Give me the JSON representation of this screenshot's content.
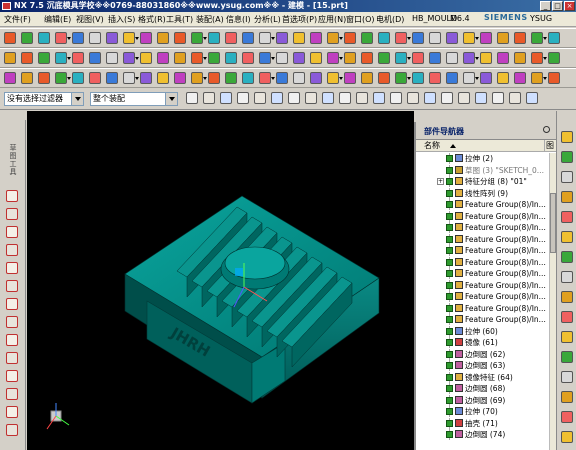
{
  "window": {
    "title": "NX 7.5 沉底模具学校※※0769-88031860※※www.ysug.com※※ - 建模 - [15.prt]",
    "controls": [
      "_",
      "□",
      "×"
    ]
  },
  "menu": {
    "items": [
      "文件(F)",
      "编辑(E)",
      "视图(V)",
      "插入(S)",
      "格式(R)",
      "工具(T)",
      "装配(A)",
      "信息(I)",
      "分析(L)",
      "首选项(P)",
      "应用(N)",
      "窗口(O)",
      "电机(D)"
    ],
    "plugins": [
      "HB_MOULD",
      "M6.4",
      "YSUG"
    ],
    "brand": "SIEMENS"
  },
  "selection_bar": {
    "filter_value": "没有选择过滤器",
    "scope_value": "整个装配"
  },
  "left_toolbar": {
    "vertical_label": "草图工具"
  },
  "navigator": {
    "title": "部件导航器",
    "col_name": "名称",
    "col_extra": "图",
    "rows": [
      {
        "label": "拉伸 (2)",
        "dim": false,
        "icon_color": "#6b8bd6"
      },
      {
        "label": "草图 (3) \"SKETCH_0...",
        "dim": true,
        "icon_color": "#c8a030"
      },
      {
        "label": "特征分组 (8) \"01\"",
        "dim": false,
        "icon_color": "#e0b040",
        "expander": "+"
      },
      {
        "label": "线性阵列 (9)",
        "dim": false,
        "icon_color": "#e0b040"
      },
      {
        "label": "Feature Group(8)/In...",
        "dim": false,
        "icon_color": "#e0b040"
      },
      {
        "label": "Feature Group(8)/In...",
        "dim": false,
        "icon_color": "#e0b040"
      },
      {
        "label": "Feature Group(8)/In...",
        "dim": false,
        "icon_color": "#e0b040"
      },
      {
        "label": "Feature Group(8)/In...",
        "dim": false,
        "icon_color": "#e0b040"
      },
      {
        "label": "Feature Group(8)/In...",
        "dim": false,
        "icon_color": "#e0b040"
      },
      {
        "label": "Feature Group(8)/In...",
        "dim": false,
        "icon_color": "#e0b040"
      },
      {
        "label": "Feature Group(8)/In...",
        "dim": false,
        "icon_color": "#e0b040"
      },
      {
        "label": "Feature Group(8)/In...",
        "dim": false,
        "icon_color": "#e0b040"
      },
      {
        "label": "Feature Group(8)/In...",
        "dim": false,
        "icon_color": "#e0b040"
      },
      {
        "label": "Feature Group(8)/In...",
        "dim": false,
        "icon_color": "#e0b040"
      },
      {
        "label": "Feature Group(8)/In...",
        "dim": false,
        "icon_color": "#e0b040"
      },
      {
        "label": "拉伸 (60)",
        "dim": false,
        "icon_color": "#6b8bd6"
      },
      {
        "label": "镜像 (61)",
        "dim": false,
        "icon_color": "#d04040"
      },
      {
        "label": "边倒圆 (62)",
        "dim": false,
        "icon_color": "#c060a0"
      },
      {
        "label": "边倒圆 (63)",
        "dim": false,
        "icon_color": "#c060a0"
      },
      {
        "label": "镜像特征 (64)",
        "dim": false,
        "icon_color": "#e0b040"
      },
      {
        "label": "边倒圆 (68)",
        "dim": false,
        "icon_color": "#c060a0"
      },
      {
        "label": "边倒圆 (69)",
        "dim": false,
        "icon_color": "#c060a0"
      },
      {
        "label": "拉伸 (70)",
        "dim": false,
        "icon_color": "#6b8bd6"
      },
      {
        "label": "抽壳 (71)",
        "dim": false,
        "icon_color": "#d04040"
      },
      {
        "label": "边倒圆 (74)",
        "dim": false,
        "icon_color": "#c060a0"
      }
    ]
  },
  "model": {
    "engraved_text": "JHRH",
    "body_color": "#006e6a"
  }
}
